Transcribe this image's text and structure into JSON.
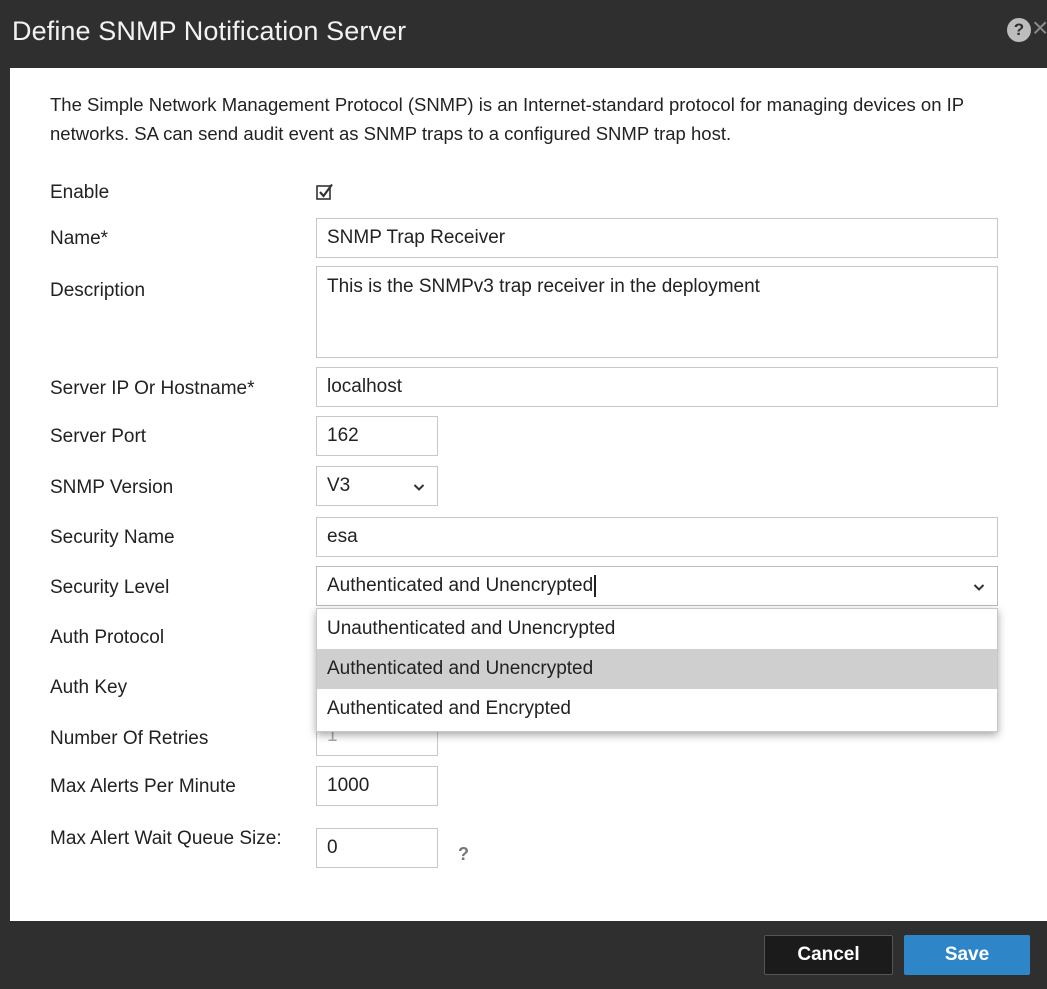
{
  "dialog": {
    "title": "Define SNMP Notification Server",
    "description": "The Simple Network Management Protocol (SNMP) is an Internet-standard protocol for managing devices on IP networks. SA can send audit event as SNMP traps to a configured SNMP trap host."
  },
  "labels": {
    "enable": "Enable",
    "name": "Name*",
    "description": "Description",
    "server_host": "Server IP Or Hostname*",
    "server_port": "Server Port",
    "snmp_version": "SNMP Version",
    "security_name": "Security Name",
    "security_level": "Security Level",
    "auth_protocol": "Auth Protocol",
    "auth_key": "Auth Key",
    "retries": "Number Of Retries",
    "max_alerts": "Max Alerts Per Minute",
    "max_wait_queue": "Max Alert Wait Queue Size:"
  },
  "values": {
    "enable_checked": true,
    "name": "SNMP Trap Receiver",
    "description": "This is the SNMPv3 trap receiver in the deployment",
    "server_host": "localhost",
    "server_port": "162",
    "snmp_version": "V3",
    "security_name": "esa",
    "security_level": "Authenticated and Unencrypted",
    "retries": "1",
    "max_alerts": "1000",
    "max_wait_queue": "0"
  },
  "security_level_options": [
    "Unauthenticated and Unencrypted",
    "Authenticated and Unencrypted",
    "Authenticated and Encrypted"
  ],
  "security_level_highlighted": "Authenticated and Unencrypted",
  "help_mark": "?",
  "buttons": {
    "cancel": "Cancel",
    "save": "Save"
  },
  "colors": {
    "titlebar": "#2f2f2f",
    "save_button": "#2e86c9",
    "cancel_button": "#1b1b1b",
    "dropdown_highlight": "#cfcfcf"
  },
  "icons": {
    "help": "help-icon",
    "close": "close-icon",
    "checkbox": "checkmark-icon",
    "dropdown": "chevron-down-icon"
  }
}
